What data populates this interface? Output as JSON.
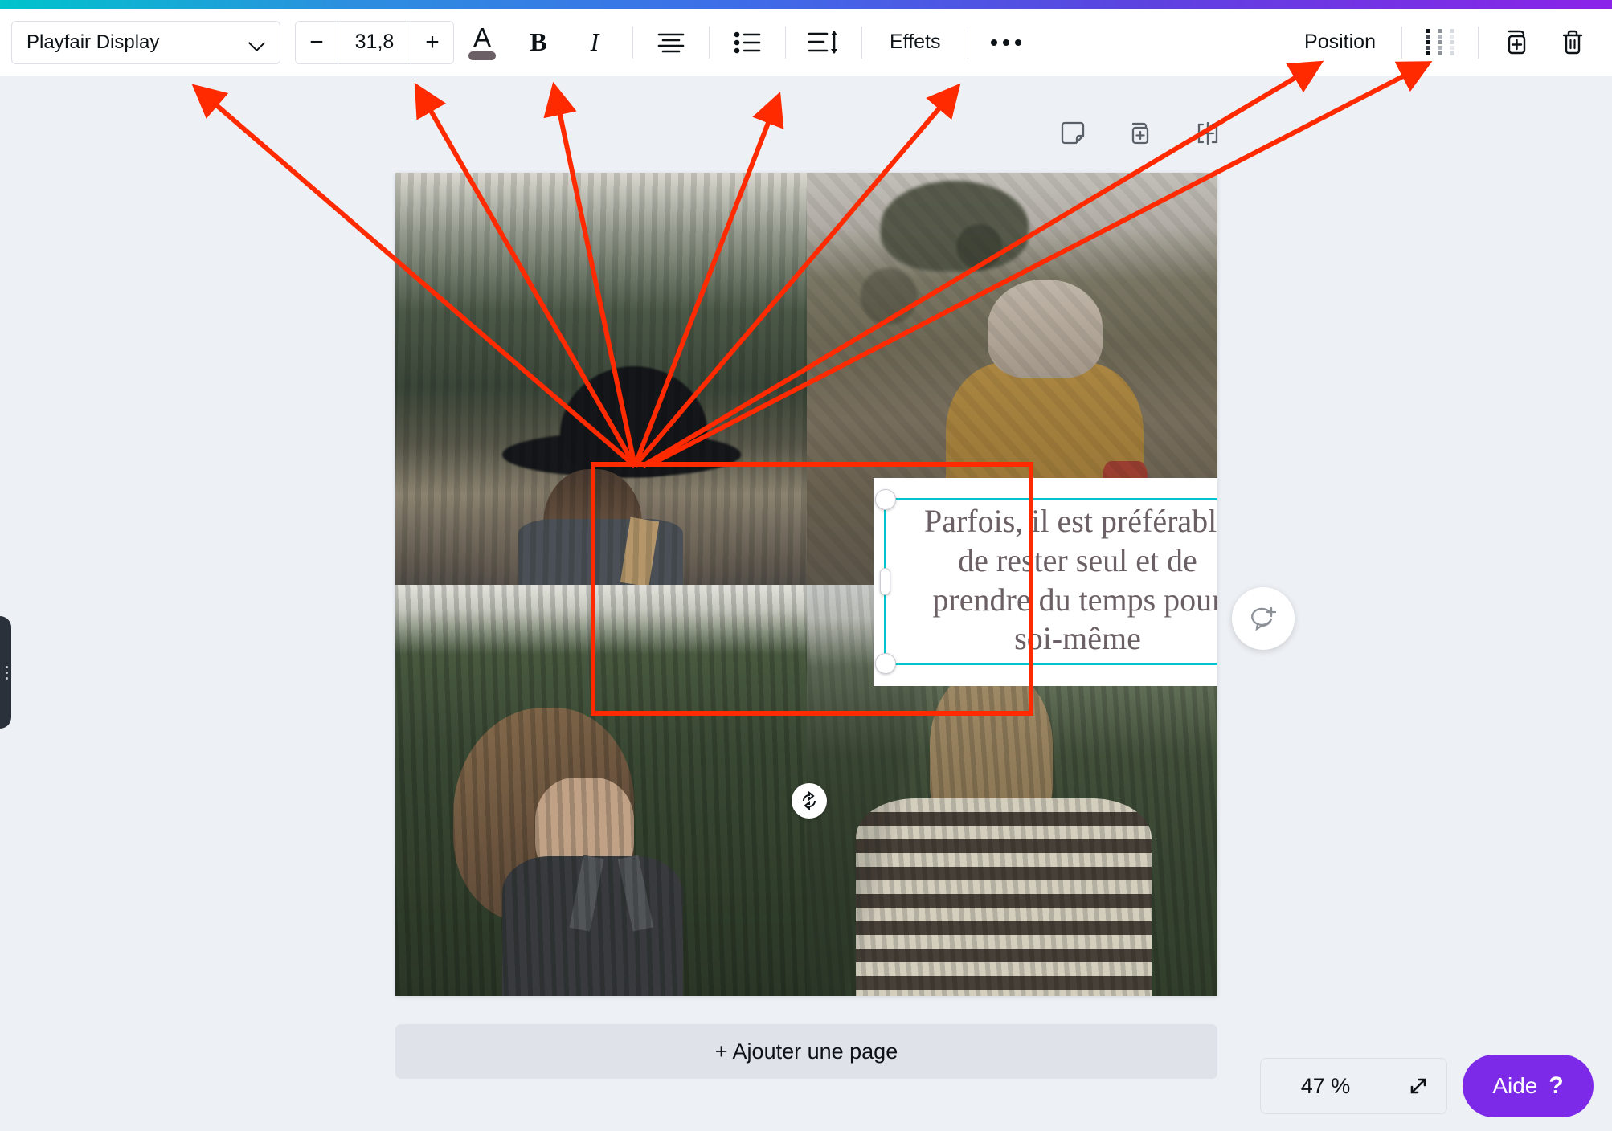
{
  "app": {
    "name": "Canva Editor",
    "locale": "fr"
  },
  "top_gradient": {
    "from": "#00c4cc",
    "mid": "#3d6ee8",
    "to": "#8b23e8"
  },
  "toolbar": {
    "font_family": "Playfair Display",
    "font_size": "31,8",
    "decrease_label": "−",
    "increase_label": "+",
    "text_color_swatch": "#6b6065",
    "bold_label": "B",
    "italic_label": "I",
    "align_icon": "align-center-icon",
    "list_icon": "bullet-list-icon",
    "spacing_icon": "line-spacing-icon",
    "effects_label": "Effets",
    "more_icon": "more-options-icon",
    "position_label": "Position",
    "transparency_icon": "transparency-icon",
    "duplicate_icon": "duplicate-icon",
    "delete_icon": "trash-icon"
  },
  "page_tools": {
    "notes_icon": "sticky-note-icon",
    "duplicate_page_icon": "duplicate-page-icon",
    "add_page_icon": "add-page-icon"
  },
  "canvas": {
    "photos": [
      {
        "name": "woman-with-hat-by-lake",
        "alt": "Femme de dos avec chapeau noir devant une forêt de sapins"
      },
      {
        "name": "person-in-mustard-coat",
        "alt": "Personne de dos en manteau moutarde dans la lande"
      },
      {
        "name": "woman-curly-hair-forest",
        "alt": "Femme de dos aux cheveux bouclés devant une forêt"
      },
      {
        "name": "woman-striped-sweater-mountain",
        "alt": "Femme de dos en pull rayé face à la montagne"
      }
    ],
    "text_element": {
      "content": "Parfois, il est préférable de rester seul et de prendre du temps pour soi-même",
      "lines": [
        "Parfois, il est préférable",
        "de rester seul et de",
        "prendre du temps pour",
        "soi-même"
      ],
      "color": "#6b6065",
      "selection_color": "#00c4cc",
      "rotate_icon": "rotate-icon"
    }
  },
  "comment_fab": {
    "icon": "add-comment-icon"
  },
  "left_panel_tab": {
    "icon": "panel-toggle-icon"
  },
  "add_page_button": {
    "label": "+ Ajouter une page"
  },
  "zoom_control": {
    "value": "47 %",
    "expand_icon": "expand-icon"
  },
  "help_button": {
    "label": "Aide",
    "mark": "?",
    "color": "#7d2ae8"
  },
  "annotations": {
    "color": "#ff2a00",
    "description": "Flèches rouges pointant de la barre d'outils vers la zone de texte sélectionnée",
    "arrow_count": 7,
    "highlight_box": "rectangle rouge autour de la zone de texte"
  }
}
